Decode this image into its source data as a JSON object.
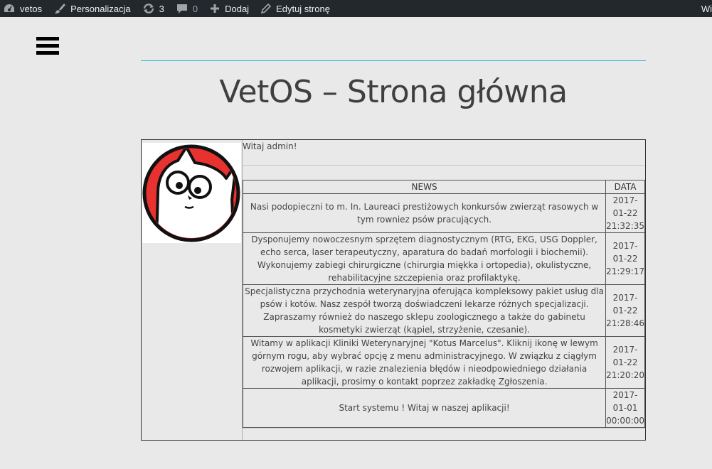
{
  "adminbar": {
    "site_name": "vetos",
    "customize": "Personalizacja",
    "updates_count": "3",
    "comments_count": "0",
    "add_new": "Dodaj",
    "edit_page": "Edytuj stronę",
    "right_text": "Wi"
  },
  "page": {
    "title": "VetOS – Strona główna",
    "welcome": "Witaj admin!"
  },
  "news": {
    "headers": {
      "news": "NEWS",
      "date": "DATA"
    },
    "rows": [
      {
        "text": "Nasi podopieczni to m. In. Laureaci prestiżowych konkursów zwierząt rasowych w tym rowniez psów pracujących.",
        "date": "2017-01-22 21:32:35"
      },
      {
        "text": "Dysponujemy nowoczesnym sprzętem diagnostycznym (RTG, EKG, USG Doppler, echo serca, laser terapeutyczny, aparatura do badań morfologii i biochemii). Wykonujemy zabiegi chirurgiczne (chirurgia miękka i ortopedia), okulistyczne, rehabilitacyjne szczepienia oraz profilaktykę.",
        "date": "2017-01-22 21:29:17"
      },
      {
        "text": "Specjalistyczna przychodnia weterynaryjna oferująca kompleksowy pakiet usług dla psów i kotów. Nasz zespół tworzą doświadczeni lekarze różnych specjalizacji. Zapraszamy również do naszego sklepu zoologicznego a także do gabinetu kosmetyki zwierząt (kąpiel, strzyżenie, czesanie).",
        "date": "2017-01-22 21:28:46"
      },
      {
        "text": "Witamy w aplikacji Kliniki Weterynaryjnej \"Kotus Marcelus\". Kliknij ikonę w lewym górnym rogu, aby wybrać opcję z menu administracyjnego. W związku z ciągłym rozwojem aplikacji, w razie znalezienia błędów i nieodpowiedniego działania aplikacji, prosimy o kontakt poprzez zakładkę Zgłoszenia.",
        "date": "2017-01-22 21:20:20"
      },
      {
        "text": "Start systemu ! Witaj w naszej aplikacji!",
        "date": "2017-01-01 00:00:00"
      }
    ]
  },
  "colors": {
    "adminbar_bg": "#23282d",
    "accent_line": "#1fb6c8",
    "avatar_red": "#e8322f"
  },
  "icons": {
    "site": "dashboard-icon",
    "customize": "brush-icon",
    "updates": "refresh-icon",
    "comments": "comment-icon",
    "add": "plus-icon",
    "edit": "pencil-icon",
    "menu": "hamburger-menu-icon"
  }
}
